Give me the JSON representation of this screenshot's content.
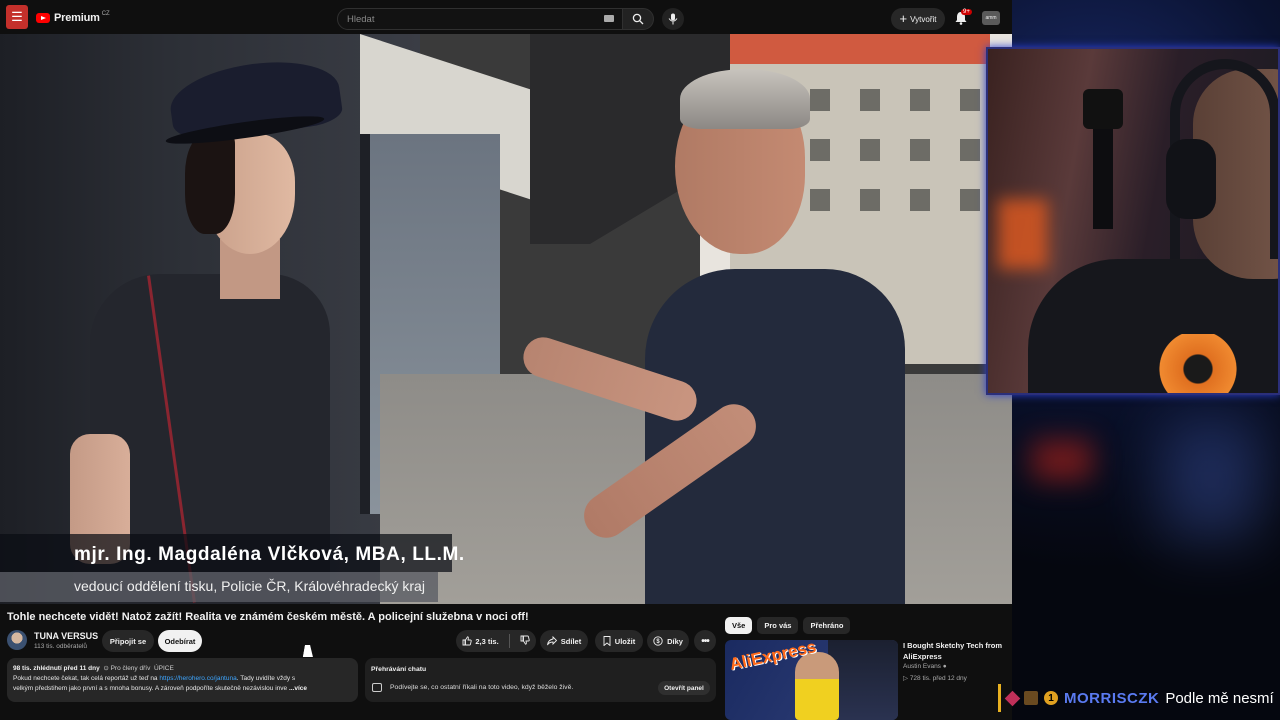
{
  "header": {
    "logo_text": "Premium",
    "logo_country": "CZ",
    "search_placeholder": "Hledat",
    "create_label": "Vytvořit",
    "notifications_badge": "9+",
    "avatar_text": "amm"
  },
  "video": {
    "lower_third_name": "mjr. Ing. Magdaléna Vlčková, MBA, LL.M.",
    "lower_third_role": "vedoucí oddělení tisku, Policie ČR, Královéhradecký kraj"
  },
  "meta": {
    "title": "Tohle nechcete vidět! Natož zažít! Realita ve známém českém městě. A policejní služebna v noci off!",
    "channel_name": "TUNA VERSUS",
    "channel_subs": "113 tis. odběratelů",
    "join_label": "Připojit se",
    "subscribed_label": "Odebírat",
    "like_count": "2,3 tis.",
    "share_label": "Sdílet",
    "save_label": "Uložit",
    "thanks_label": "Díky"
  },
  "description": {
    "views_time": "98 tis. zhlédnutí  před 11 dny",
    "members": "Pro členy dřív",
    "tag": "ÚPICE",
    "line1_before": "Pokud nechcete čekat, tak celá reportáž už teď na",
    "link": "https://herohero.co/jantuna",
    "line1_after": ". Tady uvidíte vždy s",
    "line2": "velkým předstihem jako první a s mnoha bonusy. A zároveň podpoříte skutečně nezávislou inve",
    "more": "...více"
  },
  "chat_replay": {
    "heading": "Přehrávání chatu",
    "text": "Podívejte se, co ostatní říkali na toto video, když běželo živě.",
    "open_label": "Otevřít panel"
  },
  "chips": [
    "Vše",
    "Pro vás",
    "Přehráno"
  ],
  "recommended": {
    "thumb_text": "AliExpress",
    "title": "I Bought Sketchy Tech from AliExpress",
    "channel": "Austin Evans",
    "meta": "728 tis.  před 12 dny"
  },
  "stream_chat": {
    "username": "MORRISCZK",
    "message": "Podle mě nesmí",
    "badge_digit": "1"
  },
  "colors": {
    "accent_red": "#ff0000",
    "link_blue": "#3ea6ff",
    "username_blue": "#5a7af0"
  }
}
